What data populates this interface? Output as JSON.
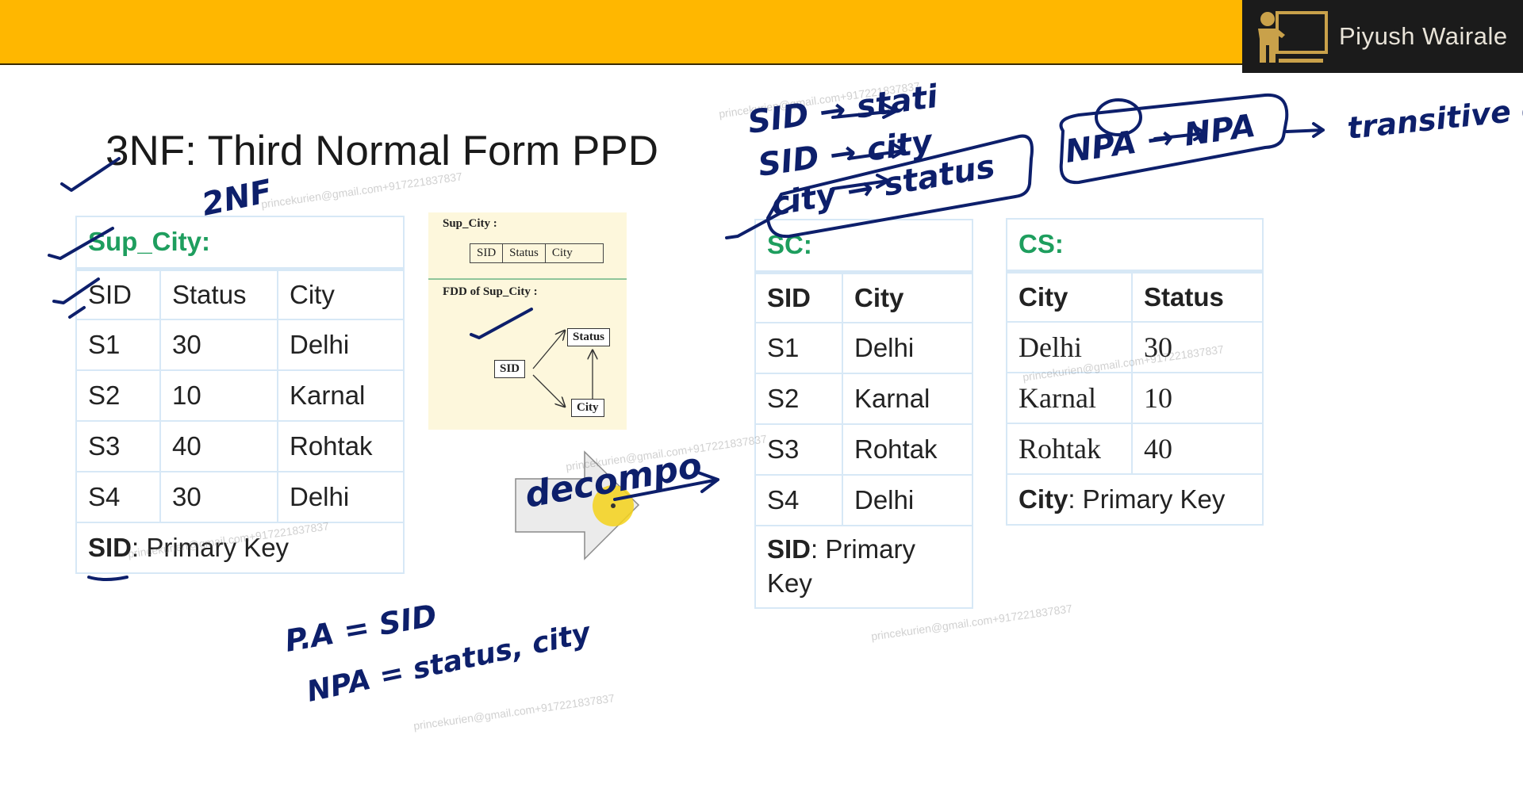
{
  "header": {
    "brand_name": "Piyush Wairale"
  },
  "slide": {
    "title": "3NF: Third Normal Form PPD"
  },
  "sup_city": {
    "heading": "Sup_City:",
    "columns": [
      "SID",
      "Status",
      "City"
    ],
    "rows": [
      [
        "S1",
        "30",
        "Delhi"
      ],
      [
        "S2",
        "10",
        "Karnal"
      ],
      [
        "S3",
        "40",
        "Rohtak"
      ],
      [
        "S4",
        "30",
        "Delhi"
      ]
    ],
    "key_attr": "SID",
    "key_text": ": Primary Key"
  },
  "fdd_panel": {
    "relation_label": "Sup_City :",
    "attributes": [
      "SID",
      "Status",
      "City"
    ],
    "fdd_label": "FDD of Sup_City :",
    "nodes": {
      "sid": "SID",
      "status": "Status",
      "city": "City"
    }
  },
  "sc": {
    "heading": "SC:",
    "columns": [
      "SID",
      "City"
    ],
    "rows": [
      [
        "S1",
        "Delhi"
      ],
      [
        "S2",
        "Karnal"
      ],
      [
        "S3",
        "Rohtak"
      ],
      [
        "S4",
        "Delhi"
      ]
    ],
    "key_attr": "SID",
    "key_text": ": Primary Key"
  },
  "cs": {
    "heading": "CS:",
    "columns": [
      "City",
      "Status"
    ],
    "rows": [
      [
        "Delhi",
        "30"
      ],
      [
        "Karnal",
        "10"
      ],
      [
        "Rohtak",
        "40"
      ]
    ],
    "key_attr": "City",
    "key_text": ": Primary Key"
  },
  "watermark": {
    "text": "princekurien@gmail.com+917221837837"
  },
  "annotations": {
    "two_nf": "2NF",
    "fd1": "SID → stati",
    "fd2": "SID → city",
    "fd3": "city → status",
    "npa_chain": "NPA → NPA",
    "transitive": "transitive depeng",
    "decompose": "decompo",
    "pa": "P.A = SID",
    "npa": "NPA = status, city"
  },
  "colors": {
    "header_bar": "#ffb700",
    "heading_green": "#1e9e5e",
    "ink": "#0d1f6b",
    "fdd_bg": "#fdf7dc",
    "cell_border": "#d7e8f6"
  }
}
